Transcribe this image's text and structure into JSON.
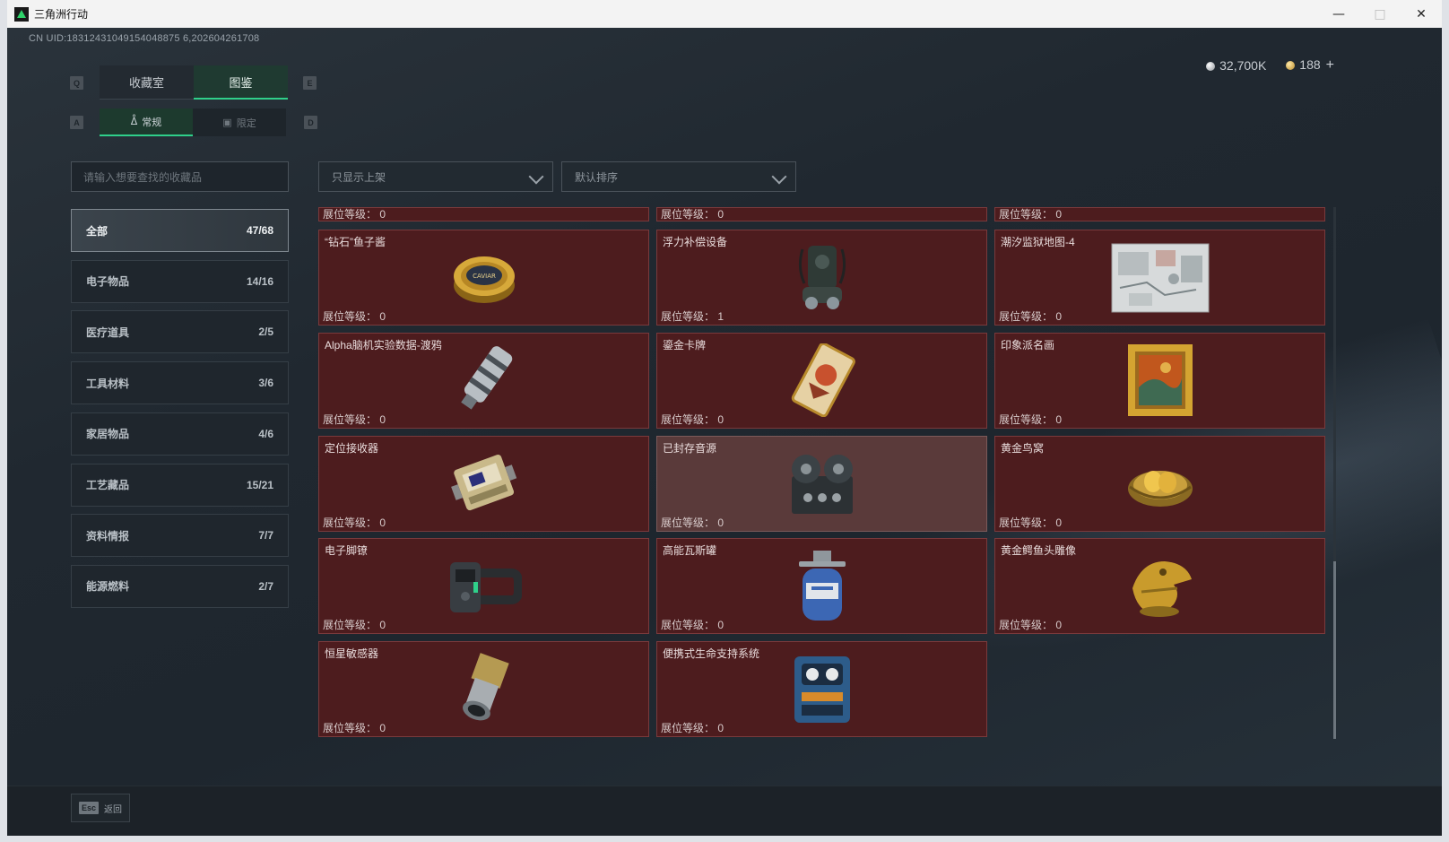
{
  "window": {
    "title": "三角洲行动",
    "controls": [
      "—",
      "□",
      "✕"
    ]
  },
  "uid": "CN UID:18312431049154048875 6,202604261708",
  "currency": {
    "silver": "32,700K",
    "gold": "188",
    "add": "+"
  },
  "tabs": {
    "key_left": "Q",
    "key_right": "E",
    "items": [
      {
        "label": "收藏室",
        "active": false
      },
      {
        "label": "图鉴",
        "active": true
      }
    ]
  },
  "subtabs": {
    "key_left": "A",
    "key_right": "D",
    "items": [
      {
        "label": "常规",
        "icon": "ᐂ",
        "active": true
      },
      {
        "label": "限定",
        "icon": "▣",
        "active": false
      }
    ]
  },
  "search": {
    "placeholder": "请输入想要查找的收藏品"
  },
  "filters": {
    "display": "只显示上架",
    "sort": "默认排序"
  },
  "categories": [
    {
      "label": "全部",
      "count": "47/68",
      "active": true
    },
    {
      "label": "电子物品",
      "count": "14/16",
      "active": false
    },
    {
      "label": "医疗道具",
      "count": "2/5",
      "active": false
    },
    {
      "label": "工具材料",
      "count": "3/6",
      "active": false
    },
    {
      "label": "家居物品",
      "count": "4/6",
      "active": false
    },
    {
      "label": "工艺藏品",
      "count": "15/21",
      "active": false
    },
    {
      "label": "资料情报",
      "count": "7/7",
      "active": false
    },
    {
      "label": "能源燃料",
      "count": "2/7",
      "active": false
    }
  ],
  "level_label": "展位等级：",
  "partial_row": [
    {
      "level": "0"
    },
    {
      "level": "0"
    },
    {
      "level": "0"
    }
  ],
  "items": [
    {
      "name": "“钻石”鱼子酱",
      "level": "0",
      "icon": "caviar-tin-icon"
    },
    {
      "name": "浮力补偿设备",
      "level": "1",
      "icon": "buoyancy-device-icon"
    },
    {
      "name": "潮汐监狱地图-4",
      "level": "0",
      "icon": "map-icon"
    },
    {
      "name": "Alpha脑机实验数据-渡鸦",
      "level": "0",
      "icon": "data-drive-icon"
    },
    {
      "name": "鎏金卡牌",
      "level": "0",
      "icon": "gilded-card-icon"
    },
    {
      "name": "印象派名画",
      "level": "0",
      "icon": "framed-painting-icon"
    },
    {
      "name": "定位接收器",
      "level": "0",
      "icon": "locator-receiver-icon"
    },
    {
      "name": "已封存音源",
      "level": "0",
      "icon": "reel-recorder-icon",
      "dim": true
    },
    {
      "name": "黄金鸟窝",
      "level": "0",
      "icon": "golden-nest-icon"
    },
    {
      "name": "电子脚镣",
      "level": "0",
      "icon": "ankle-monitor-icon"
    },
    {
      "name": "高能瓦斯罐",
      "level": "0",
      "icon": "gas-canister-icon"
    },
    {
      "name": "黄金鳄鱼头雕像",
      "level": "0",
      "icon": "crocodile-statue-icon"
    },
    {
      "name": "恒星敏感器",
      "level": "0",
      "icon": "star-sensor-icon"
    },
    {
      "name": "便携式生命支持系统",
      "level": "0",
      "icon": "life-support-icon"
    }
  ],
  "esc": {
    "key": "Esc",
    "label": "返回"
  }
}
